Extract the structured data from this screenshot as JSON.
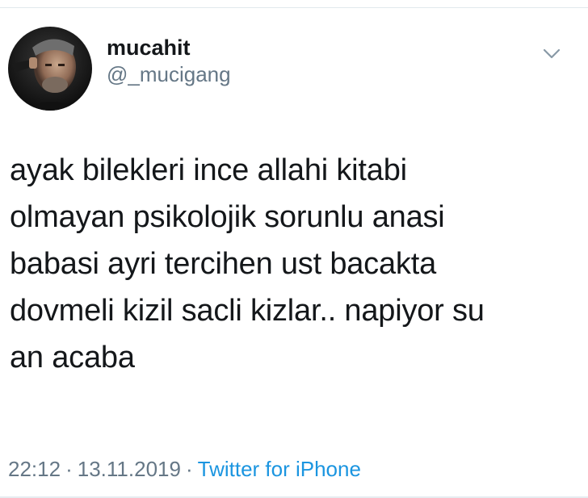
{
  "user": {
    "display_name": "mucahit",
    "handle": "@_mucigang"
  },
  "tweet": {
    "lines": [
      "ayak bilekleri ince allahi kitabi",
      "olmayan psikolojik sorunlu anasi",
      "babasi ayri tercihen ust bacakta",
      "dovmeli kizil sacli kizlar.. napiyor su",
      "an acaba"
    ]
  },
  "meta": {
    "time": "22:12",
    "date": "13.11.2019",
    "source": "Twitter for iPhone",
    "separator": "·"
  },
  "icons": {
    "caret": "chevron-down-icon"
  },
  "colors": {
    "text": "#14171a",
    "secondary": "#657786",
    "link": "#1b95e0",
    "border": "#e1e8ed"
  }
}
